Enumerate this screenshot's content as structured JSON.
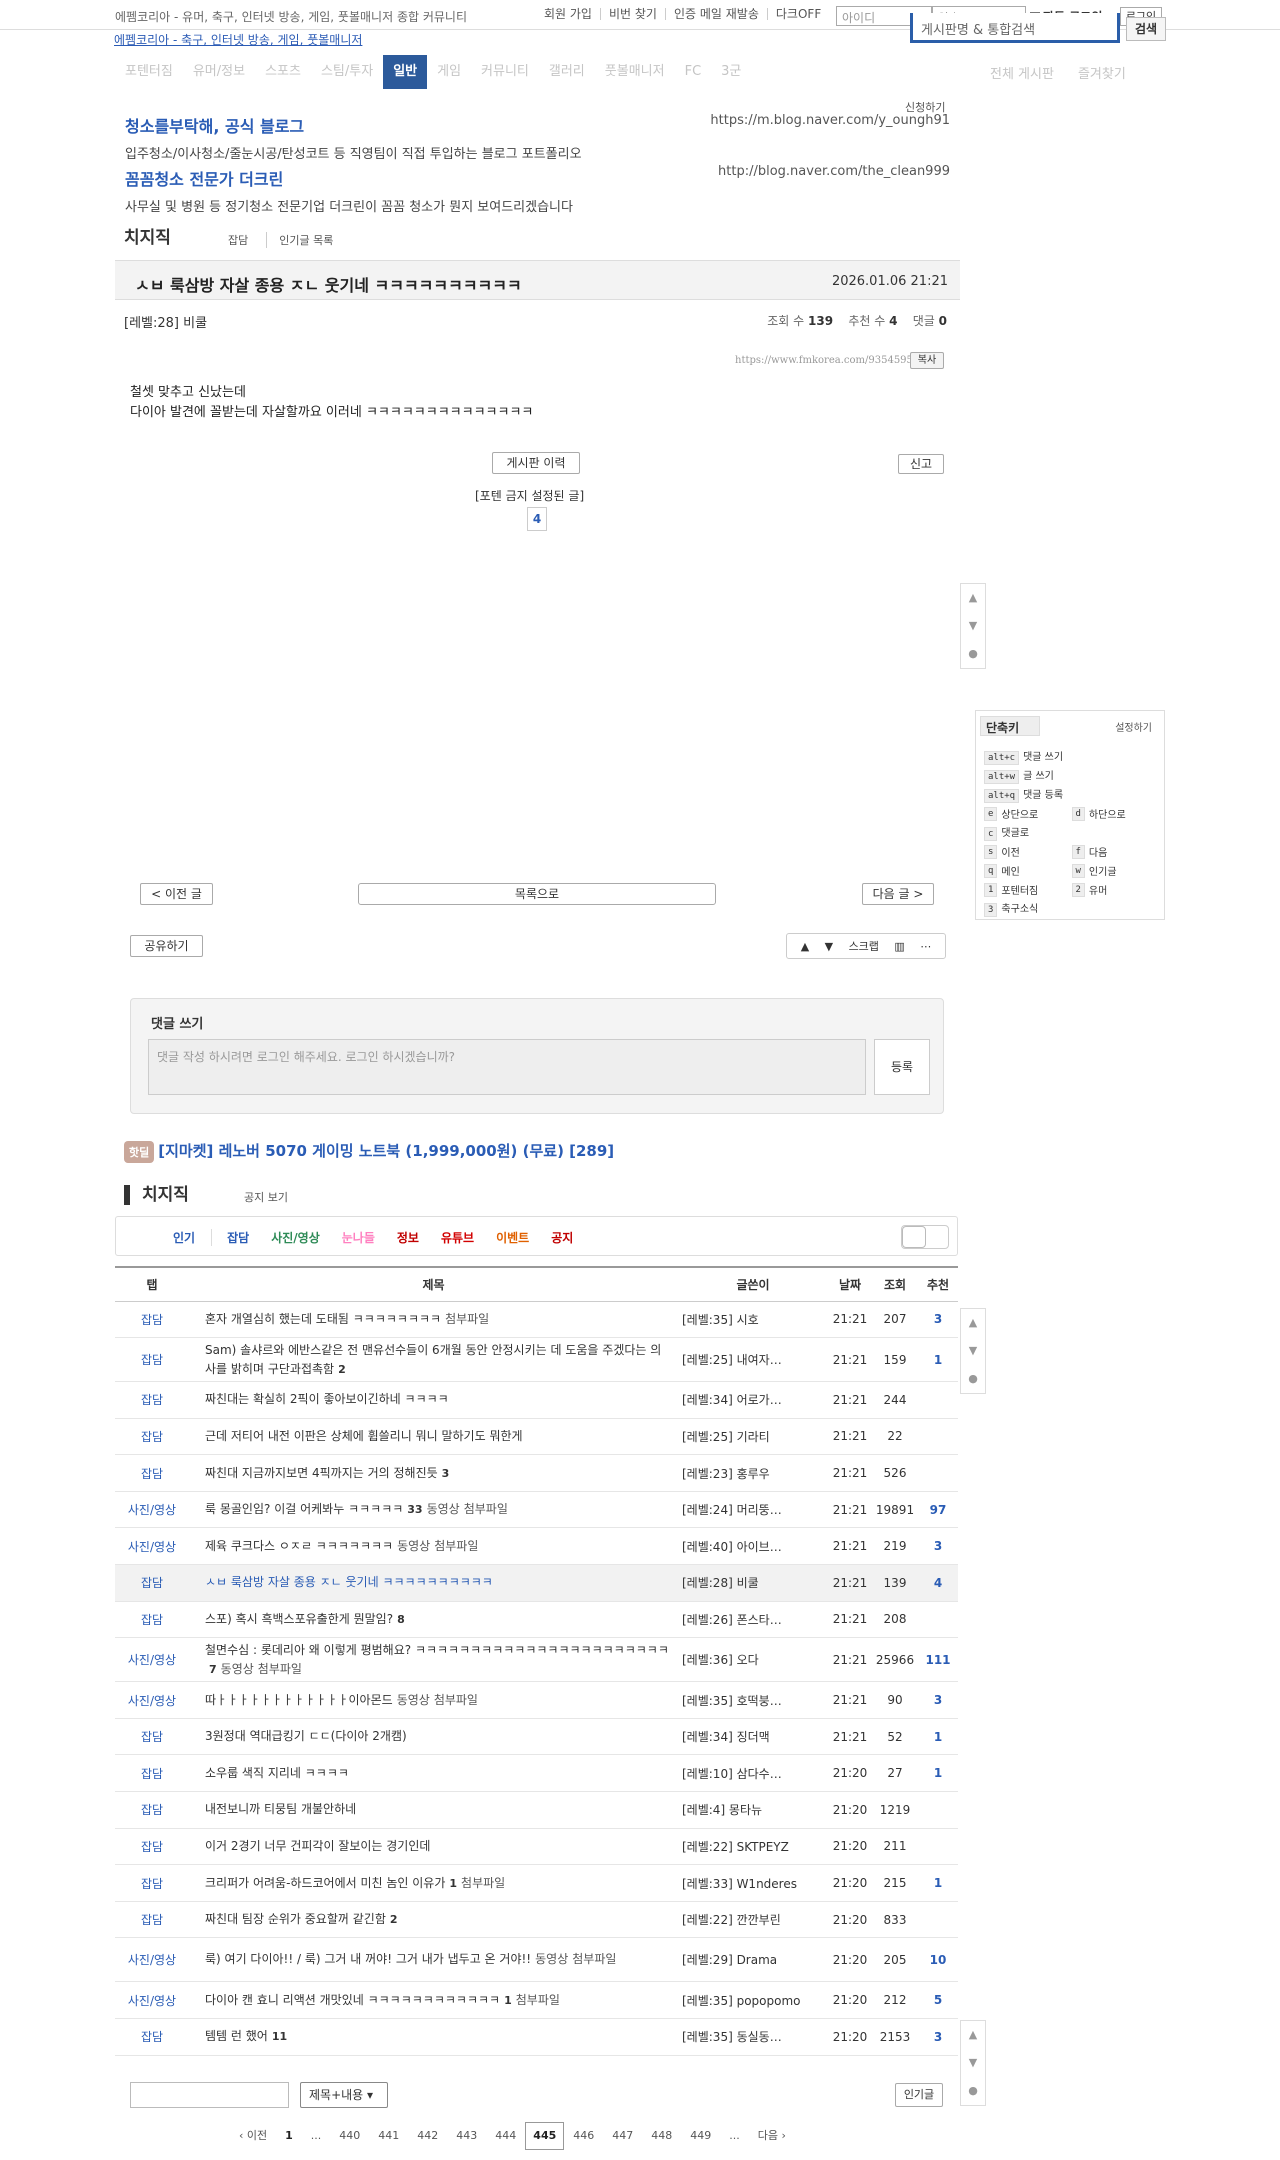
{
  "topbar": {
    "site_desc": "에펨코리아 - 유머, 축구, 인터넷 방송, 게임, 풋볼매니저 종합 커뮤니티",
    "links": [
      "회원 가입",
      "비번 찾기",
      "인증 메일 재발송",
      "다크OFF"
    ],
    "id_placeholder": "아이디",
    "pw_placeholder": "암호",
    "auto_login": "자동 로그인",
    "login_btn": "로그인"
  },
  "logo_alt": "에펨코리아 - 축구, 인터넷 방송, 게임, 풋볼매니저",
  "search": {
    "placeholder": "게시판명 & 통합검색",
    "button": "검색"
  },
  "nav": {
    "items": [
      "포텐터짐",
      "유머/정보",
      "스포츠",
      "스팀/투자",
      "일반",
      "게임",
      "커뮤니티",
      "갤러리",
      "풋볼매니저",
      "FC",
      "3군"
    ],
    "active": "일반",
    "right": [
      "전체 게시판",
      "즐겨찾기"
    ]
  },
  "ads": {
    "apply": "신청하기",
    "items": [
      {
        "title": "청소를부탁해, 공식 블로그",
        "desc": "입주청소/이사청소/줄눈시공/탄성코트 등 직영팀이 직접 투입하는 블로그 포트폴리오",
        "url": "https://m.blog.naver.com/y_oungh91"
      },
      {
        "title": "꼼꼼청소 전문가 더크린",
        "desc": "사무실 및 병원 등 정기청소 전문기업 더크린이 꼼꼼 청소가 뭔지 보여드리겠습니다",
        "url": "http://blog.naver.com/the_clean999"
      }
    ]
  },
  "board": {
    "name": "치지직",
    "tabs": [
      "잡담",
      "인기글 목록"
    ]
  },
  "post": {
    "title": "ㅅㅂ 룩삼방 자살 종용 ㅈㄴ 웃기네 ㅋㅋㅋㅋㅋㅋㅋㅋㅋㅋ",
    "date": "2026.01.06 21:21",
    "author": "[레벨:28] 비쿨",
    "views_label": "조회 수",
    "views": "139",
    "likes_label": "추천 수",
    "likes": "4",
    "comments_label": "댓글",
    "comments": "0",
    "url": "https://www.fmkorea.com/9354595173",
    "copy": "복사",
    "content": [
      "철셋 맞추고 신났는데",
      "다이아 발견에 꼴받는데 자살할까요 이러네 ㅋㅋㅋㅋㅋㅋㅋㅋㅋㅋㅋㅋㅋㅋ"
    ],
    "board_history": "게시판 이력",
    "report": "신고",
    "foten_note": "[포텐 금지 설정된 글]",
    "foten_count": "4"
  },
  "shortcuts": {
    "title": "단축키",
    "settings": "설정하기",
    "rows": [
      [
        {
          "k": "alt+c",
          "l": "댓글 쓰기"
        }
      ],
      [
        {
          "k": "alt+w",
          "l": "글 쓰기"
        }
      ],
      [
        {
          "k": "alt+q",
          "l": "댓글 등록"
        }
      ],
      [
        {
          "k": "e",
          "l": "상단으로"
        },
        {
          "k": "d",
          "l": "하단으로"
        }
      ],
      [
        {
          "k": "c",
          "l": "댓글로"
        }
      ],
      [
        {
          "k": "s",
          "l": "이전"
        },
        {
          "k": "f",
          "l": "다음"
        }
      ],
      [
        {
          "k": "q",
          "l": "메인"
        },
        {
          "k": "w",
          "l": "인기글"
        }
      ],
      [
        {
          "k": "1",
          "l": "포텐터짐"
        },
        {
          "k": "2",
          "l": "유머"
        }
      ],
      [
        {
          "k": "3",
          "l": "축구소식"
        }
      ]
    ]
  },
  "postnav": {
    "prev": "< 이전 글",
    "list": "목록으로",
    "next": "다음 글 >",
    "share": "공유하기",
    "scrap": "스크랩"
  },
  "comment_form": {
    "label": "댓글 쓰기",
    "placeholder": "댓글 작성 하시려면 로그인 해주세요. 로그인 하시겠습니까?",
    "submit": "등록"
  },
  "hotdeal": {
    "badge": "핫딜",
    "text": "[지마켓] 레노버 5070 게이밍 노트북 (1,999,000원) (무료) [289]"
  },
  "list_board": {
    "name": "치지직",
    "notice_view": "공지 보기"
  },
  "cat_tabs": [
    {
      "label": "인기",
      "color": "#2a5cb5"
    },
    {
      "label": "잡담",
      "color": "#2a5cb5"
    },
    {
      "label": "사진/영상",
      "color": "#2e8b57"
    },
    {
      "label": "눈나들",
      "color": "#ff80c0"
    },
    {
      "label": "정보",
      "color": "#c00000"
    },
    {
      "label": "유튜브",
      "color": "#d20000"
    },
    {
      "label": "이벤트",
      "color": "#e06000"
    },
    {
      "label": "공지",
      "color": "#c00000"
    }
  ],
  "table": {
    "headers": [
      "탭",
      "제목",
      "글쓴이",
      "날짜",
      "조회",
      "추천"
    ],
    "rows": [
      {
        "cat": "잡담",
        "title": "혼자 개열심히 했는데 도태됨 ㅋㅋㅋㅋㅋㅋㅋㅋ",
        "cm": "",
        "att": "첨부파일",
        "vid": "",
        "author": "[레벨:35] 시호",
        "time": "21:21",
        "views": "207",
        "rec": "3"
      },
      {
        "cat": "잡담",
        "title": "Sam) 솔샤르와 에반스같은 전 맨유선수들이 6개월 동안 안정시키는 데 도움을 주겠다는 의사를 밝히며 구단과접촉함",
        "cm": "2",
        "att": "",
        "vid": "",
        "author": "[레벨:25] 내여자…",
        "time": "21:21",
        "views": "159",
        "rec": "1"
      },
      {
        "cat": "잡담",
        "title": "짜친대는 확실히 2픽이 좋아보이긴하네 ㅋㅋㅋㅋ",
        "cm": "",
        "att": "",
        "vid": "",
        "author": "[레벨:34] 어로가…",
        "time": "21:21",
        "views": "244",
        "rec": ""
      },
      {
        "cat": "잡담",
        "title": "근데 저티어 내전 이판은 상체에 휩쓸리니 뭐니 말하기도 뭐한게",
        "cm": "",
        "att": "",
        "vid": "",
        "author": "[레벨:25] 기라티",
        "time": "21:21",
        "views": "22",
        "rec": ""
      },
      {
        "cat": "잡담",
        "title": "짜친대 지금까지보면 4픽까지는 거의 정해진듯",
        "cm": "3",
        "att": "",
        "vid": "",
        "author": "[레벨:23] 홍루우",
        "time": "21:21",
        "views": "526",
        "rec": ""
      },
      {
        "cat": "사진/영상",
        "title": "룩 몽골인임? 이걸 어케봐누 ㅋㅋㅋㅋㅋ",
        "cm": "33",
        "att": "첨부파일",
        "vid": "동영상",
        "author": "[레벨:24] 머리뚱…",
        "time": "21:21",
        "views": "19891",
        "rec": "97"
      },
      {
        "cat": "사진/영상",
        "title": "제육 쿠크다스 ㅇㅈㄹ ㅋㅋㅋㅋㅋㅋㅋ",
        "cm": "",
        "att": "첨부파일",
        "vid": "동영상",
        "author": "[레벨:40] 아이브…",
        "time": "21:21",
        "views": "219",
        "rec": "3"
      },
      {
        "cat": "잡담",
        "title": "ㅅㅂ 룩삼방 자살 종용 ㅈㄴ 웃기네 ㅋㅋㅋㅋㅋㅋㅋㅋㅋㅋ",
        "cm": "",
        "att": "",
        "vid": "",
        "author": "[레벨:28] 비쿨",
        "time": "21:21",
        "views": "139",
        "rec": "4",
        "hl": true
      },
      {
        "cat": "잡담",
        "title": "스포) 혹시 흑백스포유출한게 뭔말임?",
        "cm": "8",
        "att": "",
        "vid": "",
        "author": "[레벨:26] 폰스타…",
        "time": "21:21",
        "views": "208",
        "rec": ""
      },
      {
        "cat": "사진/영상",
        "title": "철면수심 : 롯데리아 왜 이렇게 평범해요? ㅋㅋㅋㅋㅋㅋㅋㅋㅋㅋㅋㅋㅋㅋㅋㅋㅋㅋㅋㅋㅋㅋㅋ",
        "cm": "7",
        "att": "첨부파일",
        "vid": "동영상",
        "author": "[레벨:36] 오다",
        "time": "21:21",
        "views": "25966",
        "rec": "111"
      },
      {
        "cat": "사진/영상",
        "title": "따ㅏㅏㅏㅏㅏㅏㅏㅏㅏㅏㅏㅏ이아몬드",
        "cm": "",
        "att": "첨부파일",
        "vid": "동영상",
        "author": "[레벨:35] 호떡붕…",
        "time": "21:21",
        "views": "90",
        "rec": "3"
      },
      {
        "cat": "잡담",
        "title": "3원정대 역대급킹기 ㄷㄷ(다이아 2개캠)",
        "cm": "",
        "att": "",
        "vid": "",
        "author": "[레벨:34] 징더맥",
        "time": "21:21",
        "views": "52",
        "rec": "1"
      },
      {
        "cat": "잡담",
        "title": "소우룹 색직 지리네 ㅋㅋㅋㅋ",
        "cm": "",
        "att": "",
        "vid": "",
        "author": "[레벨:10] 삼다수…",
        "time": "21:20",
        "views": "27",
        "rec": "1"
      },
      {
        "cat": "잡담",
        "title": "내전보니까 티뭉팀 개불안하네",
        "cm": "",
        "att": "",
        "vid": "",
        "author": "[레벨:4] 몽타뉴",
        "time": "21:20",
        "views": "1219",
        "rec": ""
      },
      {
        "cat": "잡담",
        "title": "이거 2경기 너무 건피각이 잘보이는 경기인데",
        "cm": "",
        "att": "",
        "vid": "",
        "author": "[레벨:22] SKTPEYZ",
        "time": "21:20",
        "views": "211",
        "rec": ""
      },
      {
        "cat": "잡담",
        "title": "크리퍼가 어려움-하드코어에서 미친 놈인 이유가",
        "cm": "1",
        "att": "첨부파일",
        "vid": "",
        "author": "[레벨:33] W1nderes",
        "time": "21:20",
        "views": "215",
        "rec": "1"
      },
      {
        "cat": "잡담",
        "title": "짜친대 팀장 순위가 중요할꺼 같긴함",
        "cm": "2",
        "att": "",
        "vid": "",
        "author": "[레벨:22] 깐깐부린",
        "time": "21:20",
        "views": "833",
        "rec": ""
      },
      {
        "cat": "사진/영상",
        "title": "룩) 여기 다이아!! / 룩) 그거 내 꺼야! 그거 내가 냅두고 온 거야!!",
        "cm": "",
        "att": "첨부파일",
        "vid": "동영상",
        "author": "[레벨:29] Drama",
        "time": "21:20",
        "views": "205",
        "rec": "10"
      },
      {
        "cat": "사진/영상",
        "title": "다이아 캔 효니 리액션 개맛있네 ㅋㅋㅋㅋㅋㅋㅋㅋㅋㅋㅋㅋ",
        "cm": "1",
        "att": "첨부파일",
        "vid": "",
        "author": "[레벨:35] popopomo",
        "time": "21:20",
        "views": "212",
        "rec": "5"
      },
      {
        "cat": "잡담",
        "title": "템템 런 했어",
        "cm": "11",
        "att": "",
        "vid": "",
        "author": "[레벨:35] 동실동…",
        "time": "21:20",
        "views": "2153",
        "rec": "3"
      }
    ]
  },
  "bottom": {
    "search_option": "제목+내용",
    "popular": "인기글",
    "pager": [
      "‹ 이전",
      "1",
      "...",
      "440",
      "441",
      "442",
      "443",
      "444",
      "445",
      "446",
      "447",
      "448",
      "449",
      "...",
      "다음 ›"
    ],
    "current": "445"
  }
}
